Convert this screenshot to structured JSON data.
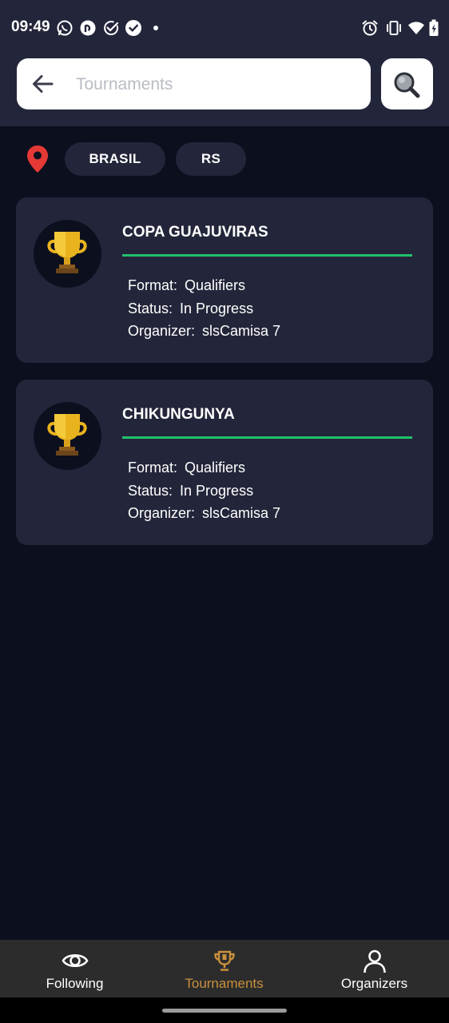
{
  "status_bar": {
    "time": "09:49",
    "notification_icons": [
      "whatsapp-icon",
      "pocketcasts-icon",
      "check-circle-icon",
      "check-circle-filled-icon",
      "dot-icon"
    ],
    "system_icons": [
      "alarm-icon",
      "vibrate-icon",
      "wifi-icon",
      "battery-icon"
    ]
  },
  "search": {
    "placeholder": "Tournaments",
    "value": ""
  },
  "filters": {
    "chips": [
      "BRASIL",
      "RS"
    ]
  },
  "labels": {
    "format": "Format:",
    "status": "Status:",
    "organizer": "Organizer:"
  },
  "tournaments": [
    {
      "name": "COPA GUAJUVIRAS",
      "format": "Qualifiers",
      "status": "In Progress",
      "organizer": "slsCamisa 7"
    },
    {
      "name": "CHIKUNGUNYA",
      "format": "Qualifiers",
      "status": "In Progress",
      "organizer": "slsCamisa 7"
    }
  ],
  "bottom_nav": {
    "items": [
      {
        "label": "Following",
        "icon": "eye-icon",
        "active": false
      },
      {
        "label": "Tournaments",
        "icon": "trophy-icon",
        "active": true
      },
      {
        "label": "Organizers",
        "icon": "person-icon",
        "active": false
      }
    ]
  },
  "colors": {
    "background": "#0c0f1e",
    "surface": "#23263a",
    "accent_line": "#21c26b",
    "active_nav": "#c9903d",
    "location_pin": "#e53935",
    "trophy_gold": "#e8b31e"
  }
}
